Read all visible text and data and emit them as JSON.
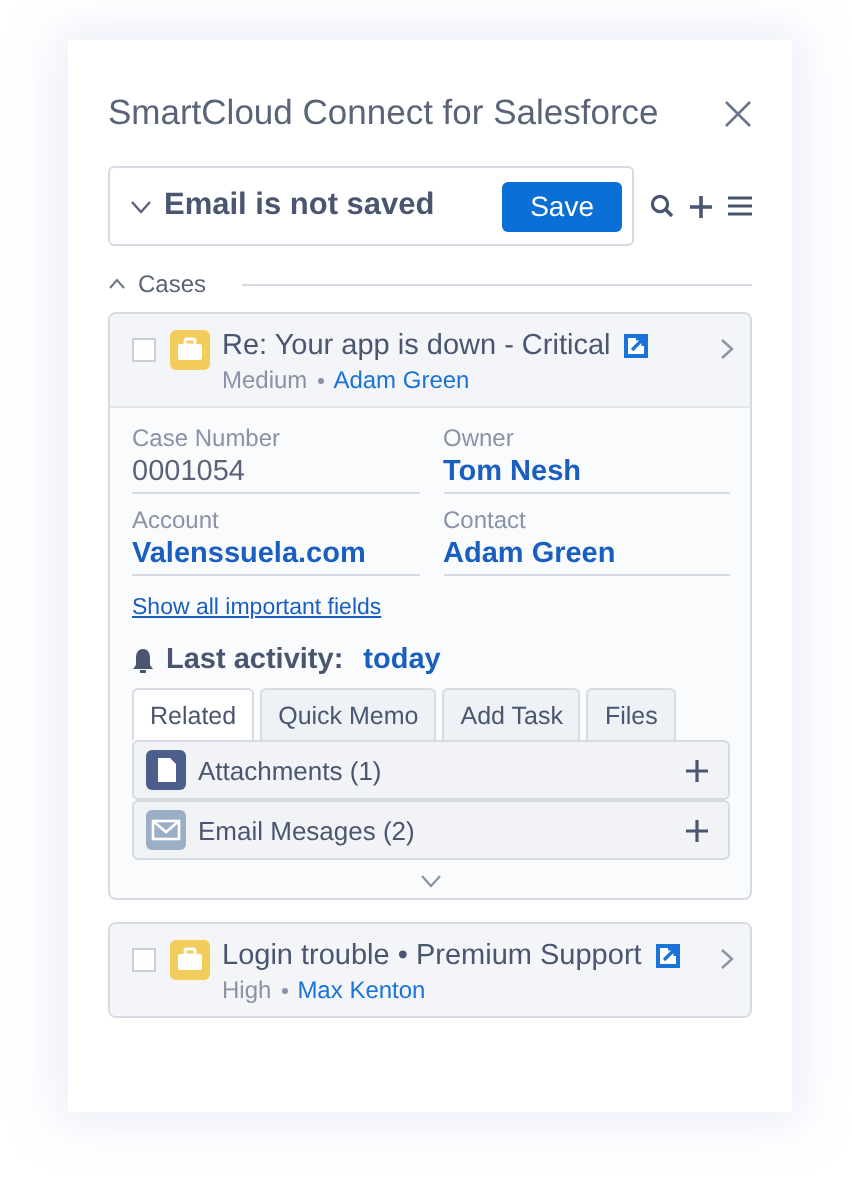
{
  "window": {
    "title": "SmartCloud Connect for Salesforce"
  },
  "email_bar": {
    "status": "Email is not saved",
    "button": "Save"
  },
  "section": {
    "title": "Cases"
  },
  "cases": [
    {
      "title": "Re: Your app is down - Critical",
      "priority": "Medium",
      "contact": "Adam Green",
      "checked": false,
      "expanded": true,
      "fields": [
        {
          "label": "Case Number",
          "value": "0001054",
          "kind": "plain"
        },
        {
          "label": "Owner",
          "value": "Tom Nesh",
          "kind": "link"
        },
        {
          "label": "Account",
          "value": "Valenssuela.com",
          "kind": "link"
        },
        {
          "label": "Contact",
          "value": "Adam Green",
          "kind": "link"
        }
      ],
      "link": "Show all important fields",
      "activity": {
        "label": "Last activity:",
        "value": "today"
      },
      "tabs": [
        {
          "label": "Related",
          "selected": true
        },
        {
          "label": "Quick Memo",
          "selected": false
        },
        {
          "label": "Add Task",
          "selected": false
        },
        {
          "label": "Files",
          "selected": false
        }
      ],
      "related": [
        {
          "label": "Attachments (1)",
          "kind": "attachment"
        },
        {
          "label": "Email Mesages (2)",
          "kind": "email"
        }
      ]
    },
    {
      "title": "Login trouble • Premium Support",
      "priority": "High",
      "contact": "Max Kenton",
      "checked": false,
      "expanded": false
    }
  ]
}
